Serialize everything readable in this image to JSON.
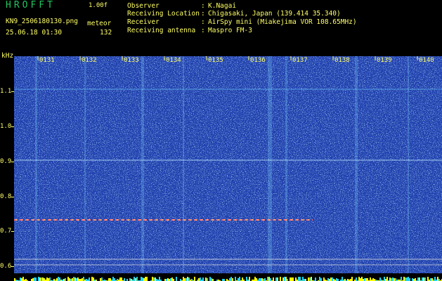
{
  "header": {
    "logo": "HROFFT",
    "version": "1.00f",
    "filename": "KN9_2506180130.png",
    "meteor_label": "meteor",
    "datetime": "25.06.18 01:30",
    "meteor_count": "132"
  },
  "metadata": [
    {
      "label": "Observer",
      "sep": ":",
      "value": "K.Nagai"
    },
    {
      "label": "Receiving Location",
      "sep": ":",
      "value": "Chigasaki, Japan (139.414 35.340)"
    },
    {
      "label": "Receiver",
      "sep": ":",
      "value": "AirSpy mini (Miakejima VOR 108.65MHz)"
    },
    {
      "label": "Receiving antenna",
      "sep": ":",
      "value": "Maspro FM-3"
    }
  ],
  "axes": {
    "y_unit": "kHz",
    "y_ticks": [
      "1.1",
      "1.0",
      "0.9",
      "0.8",
      "0.7",
      "0.6"
    ],
    "x_ticks": [
      "0131",
      "0132",
      "0133",
      "0134",
      "0135",
      "0136",
      "0137",
      "0138",
      "0139",
      "0140"
    ]
  },
  "colors": {
    "background": "#000000",
    "label_yellow": "#ffff66",
    "logo_green": "#22c55e",
    "spectrogram_blue": "#1f3fae",
    "signal_line": "#ff6666"
  }
}
